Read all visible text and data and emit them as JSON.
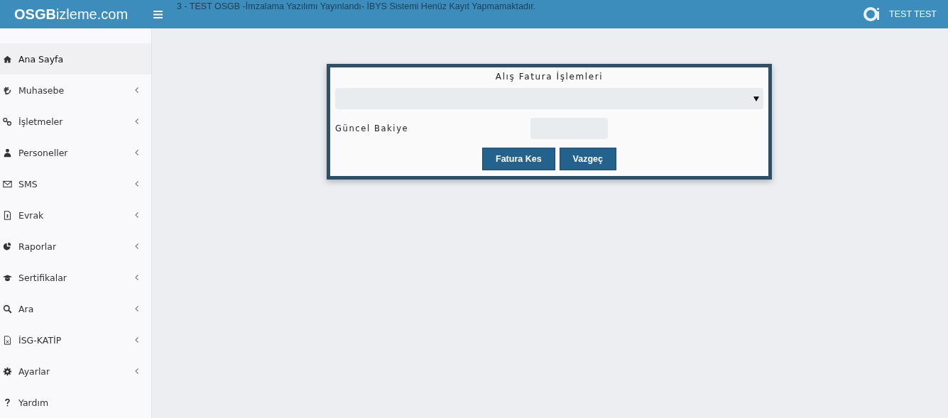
{
  "header": {
    "logo": "**OSGB**izleme.com",
    "announcement": "3 - TEST OSGB -İmzalama Yazılımı Yayınlandı- İBYS Sistemi Henüz Kayıt Yapmamaktadır.",
    "user_name": "TEST TEST"
  },
  "sidebar": {
    "items": [
      {
        "label": "Ana Sayfa",
        "selected": true,
        "expandable": false
      },
      {
        "label": "Muhasebe",
        "selected": false,
        "expandable": true
      },
      {
        "label": "İşletmeler",
        "selected": false,
        "expandable": true
      },
      {
        "label": "Personeller",
        "selected": false,
        "expandable": true
      },
      {
        "label": "SMS",
        "selected": false,
        "expandable": true
      },
      {
        "label": "Evrak",
        "selected": false,
        "expandable": true
      },
      {
        "label": "Raporlar",
        "selected": false,
        "expandable": true
      },
      {
        "label": "Sertifikalar",
        "selected": false,
        "expandable": true
      },
      {
        "label": "Ara",
        "selected": false,
        "expandable": true
      },
      {
        "label": "İSG-KATİP",
        "selected": false,
        "expandable": true
      },
      {
        "label": "Ayarlar",
        "selected": false,
        "expandable": true
      },
      {
        "label": "Yardım",
        "selected": false,
        "expandable": false
      }
    ]
  },
  "dialog": {
    "title": "Alış Fatura İşlemleri",
    "balance_label": "Güncel Bakiye",
    "buttons": [
      "Fatura Kes",
      "Vazgeç"
    ]
  }
}
